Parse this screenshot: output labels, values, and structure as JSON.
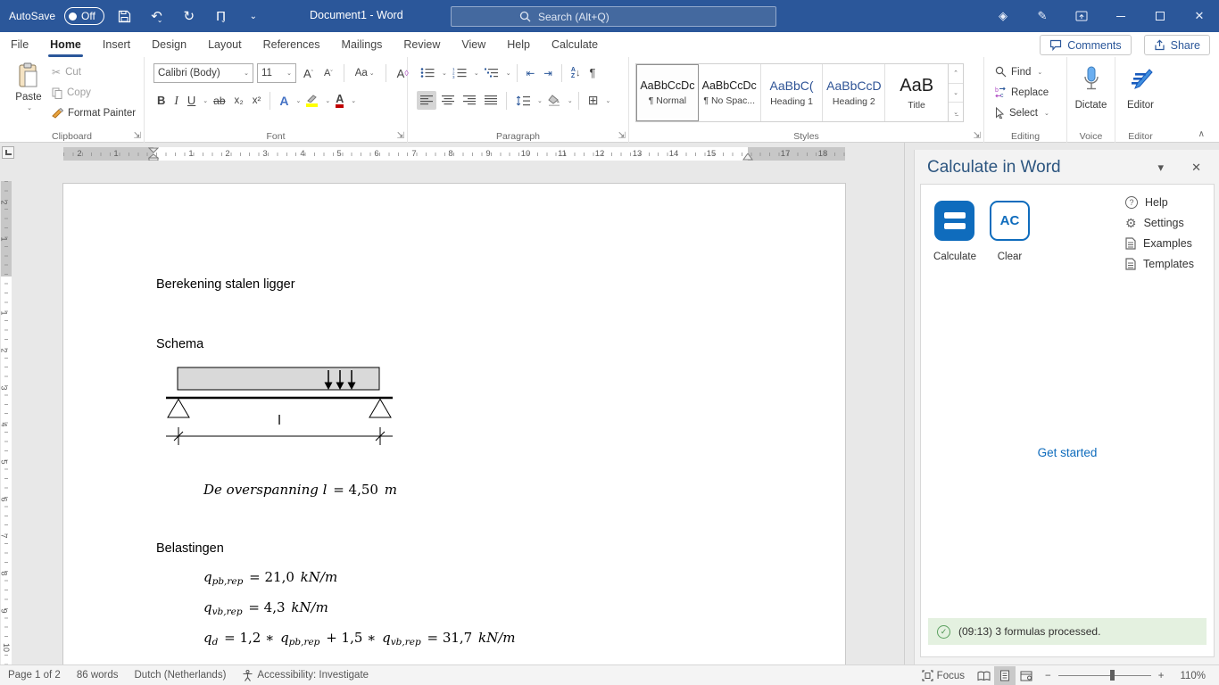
{
  "titlebar": {
    "autosave": "AutoSave",
    "autosave_state": "Off",
    "title": "Document1 - Word",
    "search": "Search (Alt+Q)"
  },
  "tabs": {
    "items": [
      "File",
      "Home",
      "Insert",
      "Design",
      "Layout",
      "References",
      "Mailings",
      "Review",
      "View",
      "Help",
      "Calculate"
    ],
    "comments": "Comments",
    "share": "Share"
  },
  "ribbon": {
    "clipboard": {
      "label": "Clipboard",
      "paste": "Paste",
      "cut": "Cut",
      "copy": "Copy",
      "format_painter": "Format Painter"
    },
    "font": {
      "label": "Font",
      "name": "Calibri (Body)",
      "size": "11",
      "bold": "B",
      "italic": "I",
      "underline": "U",
      "strike": "ab",
      "sub": "x₂",
      "sup": "x²",
      "letters": {
        "grow": "A",
        "shrink": "A",
        "case": "Aa",
        "clear": "A",
        "effects": "A",
        "color": "A"
      }
    },
    "paragraph": {
      "label": "Paragraph",
      "pilcrow": "¶",
      "sort_a": "A",
      "sort_z": "Z"
    },
    "styles": {
      "label": "Styles",
      "items": [
        {
          "preview": "AaBbCcDc",
          "name": "¶ Normal"
        },
        {
          "preview": "AaBbCcDc",
          "name": "¶ No Spac..."
        },
        {
          "preview": "AaBbC(",
          "name": "Heading 1"
        },
        {
          "preview": "AaBbCcD",
          "name": "Heading 2"
        },
        {
          "preview": "AaB",
          "name": "Title"
        }
      ]
    },
    "editing": {
      "label": "Editing",
      "find": "Find",
      "replace": "Replace",
      "select": "Select"
    },
    "voice": {
      "label": "Voice",
      "dictate": "Dictate"
    },
    "editor": {
      "label": "Editor",
      "button": "Editor"
    }
  },
  "ruler": {
    "h_left": [
      "2",
      "1"
    ],
    "h_main": [
      "1",
      "2",
      "3",
      "4",
      "5",
      "6",
      "7",
      "8",
      "9",
      "10",
      "11",
      "12",
      "13",
      "14",
      "15"
    ],
    "h_right": [
      "17",
      "18"
    ],
    "v_top": [
      "2",
      "1"
    ],
    "v_main": [
      "1",
      "2",
      "3",
      "4",
      "5",
      "6",
      "7",
      "8",
      "9",
      "10"
    ]
  },
  "document": {
    "title": "Berekening stalen ligger",
    "schema_heading": "Schema",
    "beam_label": "l",
    "span_formula": {
      "lhs": "De overspanning l",
      "eq": "= 4,50",
      "unit": "m"
    },
    "loads_heading": "Belastingen",
    "f1": {
      "base": "q",
      "sub": "pb,rep",
      "eq": "= 21,0",
      "unit": "kN/m"
    },
    "f2": {
      "base": "q",
      "sub": "vb,rep",
      "eq": "= 4,3",
      "unit": "kN/m"
    },
    "f3": {
      "b1": "q",
      "s1": "d",
      "m1": "= 1,2 ∗",
      "b2": "q",
      "s2": "pb,rep",
      "m2": "+ 1,5 ∗",
      "b3": "q",
      "s3": "vb,rep",
      "m3": "= 31,7",
      "unit": "kN/m"
    }
  },
  "panel": {
    "title": "Calculate in Word",
    "calculate": "Calculate",
    "clear": "Clear",
    "clear_icon": "AC",
    "links": {
      "help": "Help",
      "settings": "Settings",
      "examples": "Examples",
      "templates": "Templates"
    },
    "get_started": "Get started",
    "status": "(09:13) 3 formulas processed."
  },
  "statusbar": {
    "page": "Page 1 of 2",
    "words": "86 words",
    "language": "Dutch (Netherlands)",
    "accessibility": "Accessibility: Investigate",
    "focus": "Focus",
    "zoom": "110%"
  },
  "colors": {
    "titlebar_blue": "#2b579a",
    "addin_blue": "#0f6cbd",
    "heading_blue": "#2f5496",
    "status_green_bg": "#e4f1e0"
  }
}
